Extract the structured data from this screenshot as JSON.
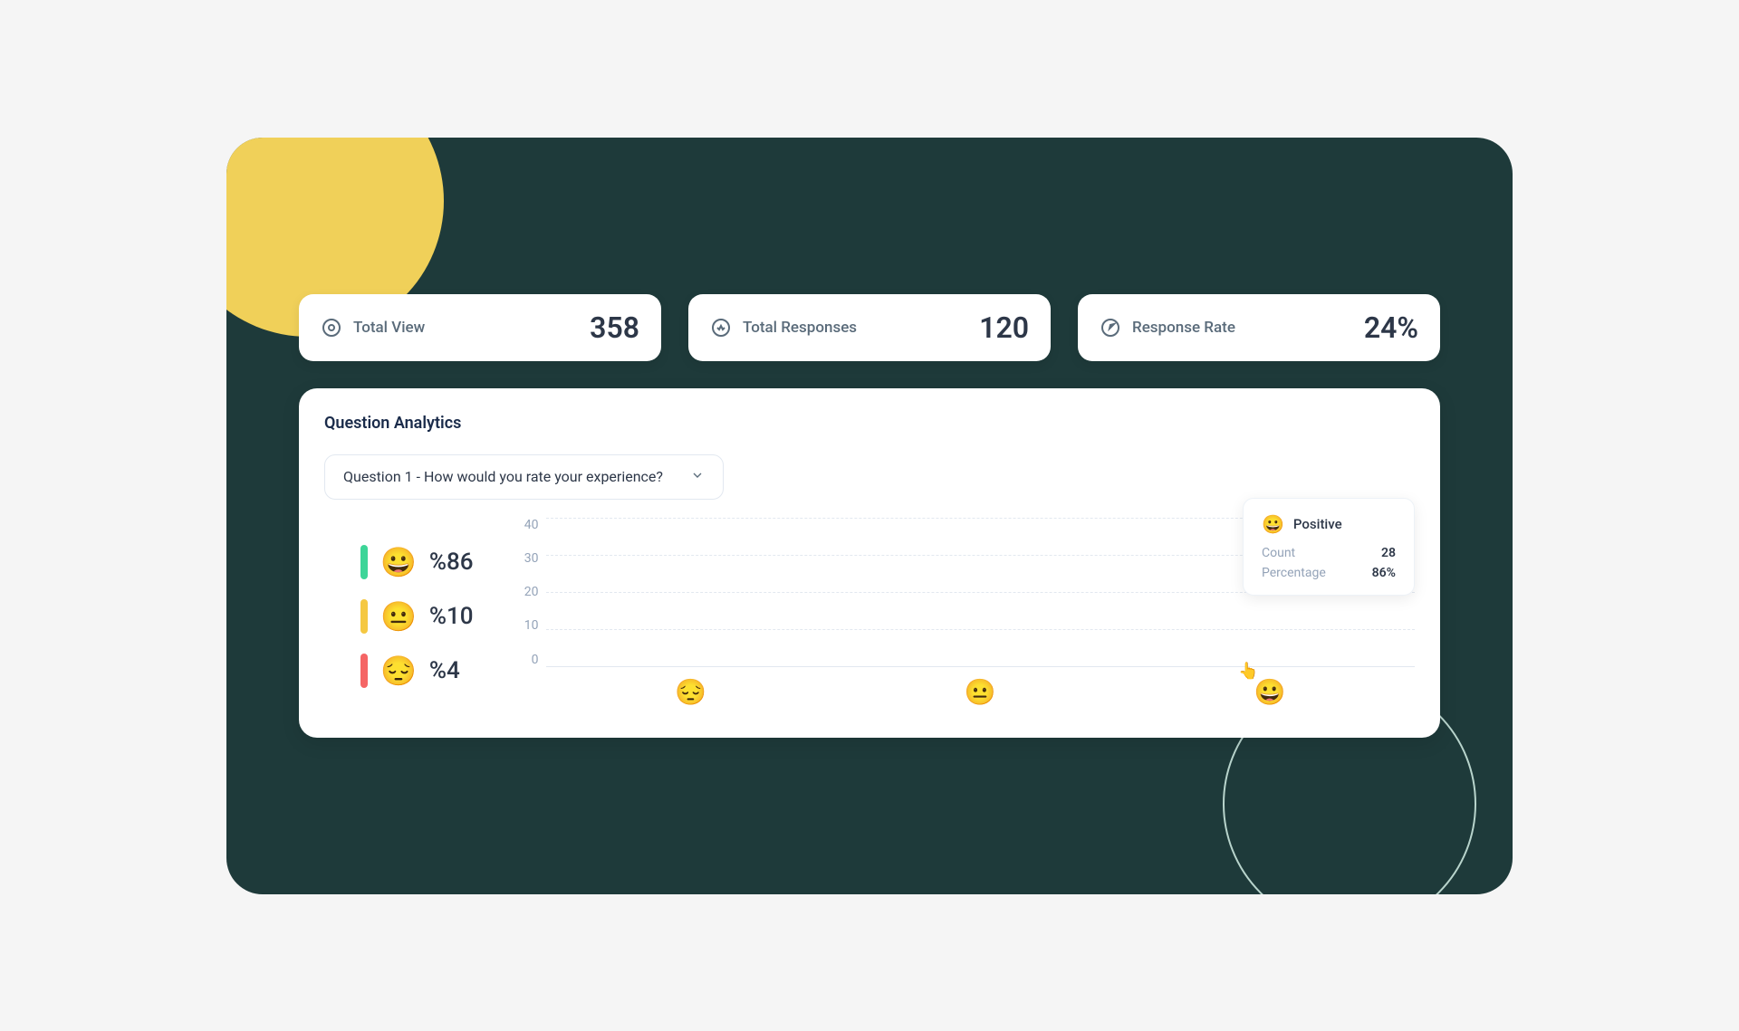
{
  "stats": [
    {
      "icon": "eye",
      "label": "Total View",
      "value": "358"
    },
    {
      "icon": "pulse",
      "label": "Total Responses",
      "value": "120"
    },
    {
      "icon": "compass",
      "label": "Response Rate",
      "value": "24%"
    }
  ],
  "analytics": {
    "title": "Question Analytics",
    "question_selected": "Question 1 - How would you rate your experience?"
  },
  "legend": [
    {
      "color": "#3dd598",
      "emoji": "😀",
      "pct": "%86"
    },
    {
      "color": "#f5c842",
      "emoji": "😐",
      "pct": "%10"
    },
    {
      "color": "#f56565",
      "emoji": "😔",
      "pct": "%4"
    }
  ],
  "tooltip": {
    "emoji": "😀",
    "title": "Positive",
    "rows": [
      {
        "label": "Count",
        "value": "28"
      },
      {
        "label": "Percentage",
        "value": "86%"
      }
    ]
  },
  "chart_data": {
    "type": "bar",
    "categories": [
      "😔",
      "😐",
      "😀"
    ],
    "values": [
      1,
      4,
      28
    ],
    "ylim": [
      0,
      40
    ],
    "yticks": [
      40,
      30,
      20,
      10,
      0
    ],
    "bar_colors": [
      "#c7d2fe",
      "#c7d2fe",
      "#818cf8"
    ],
    "title": "",
    "xlabel": "",
    "ylabel": ""
  }
}
